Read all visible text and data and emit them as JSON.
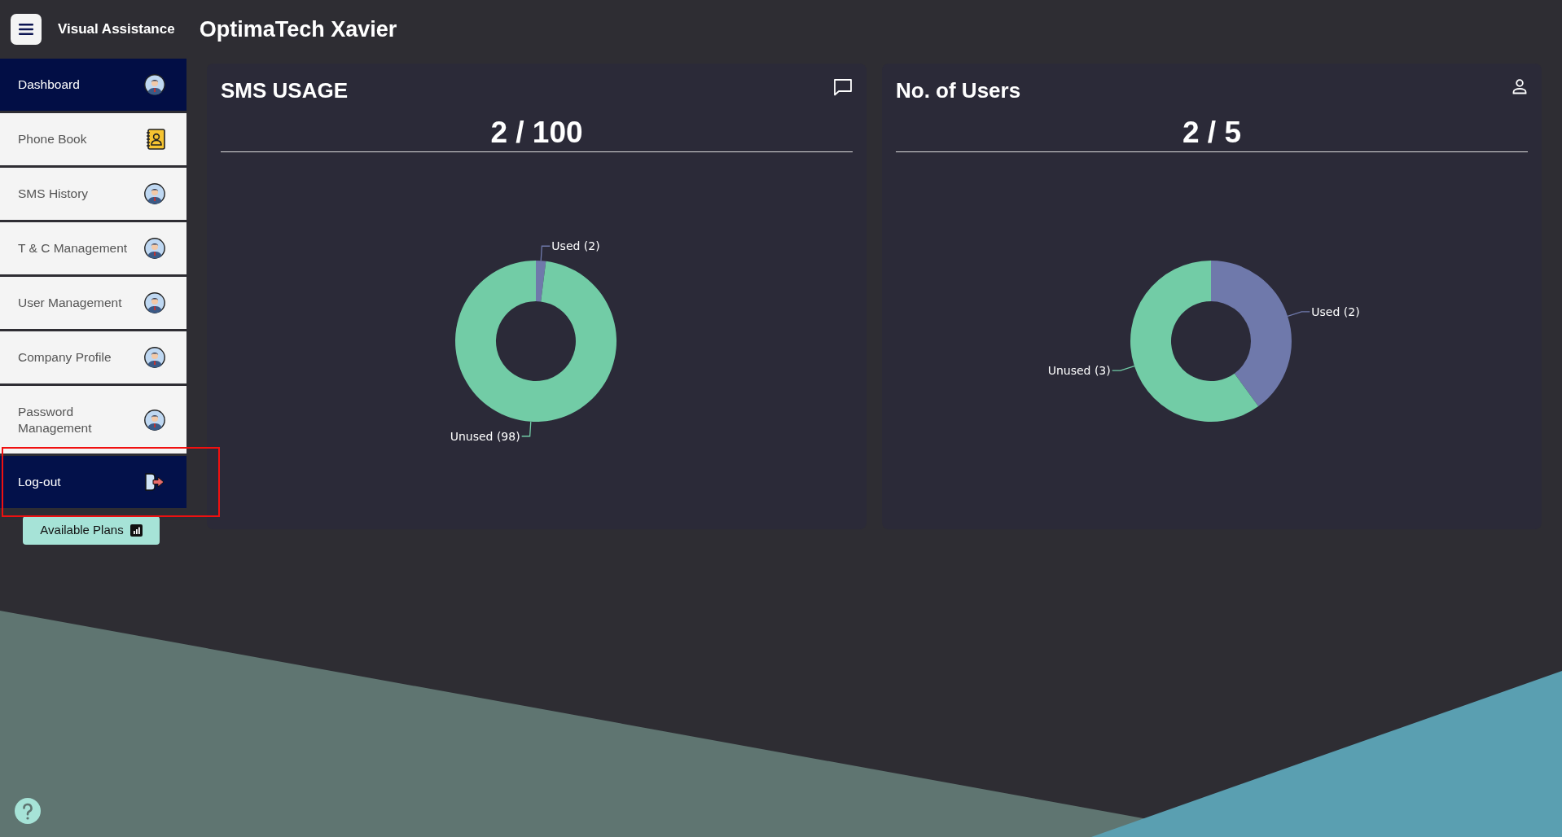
{
  "header": {
    "app_name": "Visual Assistance",
    "title": "OptimaTech Xavier"
  },
  "sidebar": {
    "items": [
      {
        "label": "Dashboard",
        "kind": "avatar",
        "selected": true
      },
      {
        "label": "Phone Book",
        "kind": "contacts",
        "selected": false
      },
      {
        "label": "SMS History",
        "kind": "avatar",
        "selected": false
      },
      {
        "label": "T & C Management",
        "kind": "avatar",
        "selected": false
      },
      {
        "label": "User Management",
        "kind": "avatar",
        "selected": false
      },
      {
        "label": "Company Profile",
        "kind": "avatar",
        "selected": false
      },
      {
        "label": "Password Management",
        "kind": "avatar",
        "selected": false
      }
    ],
    "logout": {
      "label": "Log-out",
      "kind": "logout",
      "highlighted": true
    },
    "plans_button": "Available Plans"
  },
  "cards": [
    {
      "title": "SMS USAGE",
      "value": "2 / 100",
      "chart_data": {
        "type": "donut",
        "categories": [
          "Used (2)",
          "Unused (98)"
        ],
        "values": [
          2,
          98
        ],
        "colors": [
          "#6f79ab",
          "#72cca6"
        ]
      }
    },
    {
      "title": "No. of Users",
      "value": "2 / 5",
      "chart_data": {
        "type": "donut",
        "categories": [
          "Used (2)",
          "Unused (3)"
        ],
        "values": [
          2,
          3
        ],
        "colors": [
          "#6f79ab",
          "#72cca6"
        ]
      }
    }
  ]
}
